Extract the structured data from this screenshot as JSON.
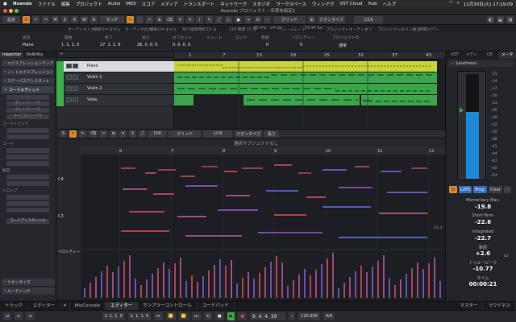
{
  "menubar": {
    "app": "Nuendo",
    "items": [
      "ファイル",
      "編集",
      "プロジェクト",
      "Audio",
      "MIDI",
      "スコア",
      "メディア",
      "トランスポート",
      "ネットワーク",
      "スタジオ",
      "ワークスペース",
      "ウィンドウ",
      "VST Cloud",
      "Hub",
      "ヘルプ"
    ],
    "clock": "11月30日(火) 17:19:09"
  },
  "titlebar": {
    "title": "Nuendo プロジェクト - 名称未設定1"
  },
  "toolbar": {
    "preset": "設定",
    "modes": [
      "M",
      "S",
      "R",
      "W",
      "A"
    ],
    "touch_mode": "タッチ",
    "grid_type": "グリッド",
    "quantize_label": "クオンタイズ",
    "quantize_value": "1/16"
  },
  "infoline": {
    "headers": [
      "名前",
      "開始",
      "終了",
      "長さ",
      "オフセット",
      "ミュート",
      "ロック",
      "移調",
      "ベロシティー",
      "プロジェクトの"
    ],
    "values": [
      "Piano",
      "1. 1. 1. 0",
      "27. 1. 1. 0",
      "26. 0. 0. 0",
      "0. 0. 0. 0",
      "",
      "",
      "0",
      "0",
      "通常"
    ],
    "status": [
      "オーディオ入力",
      "接続されません",
      "オーディオ出力",
      "接続されません",
      "残り録音時間 15 分",
      "120 時間 15 分",
      "48 kHz - 24 bit",
      "フレームレート",
      "59.94 fps",
      "プロジェクトオーディオ",
      "オフ",
      "プロジェクトのパン規正",
      "時間/パワー"
    ]
  },
  "inspector": {
    "tabs": [
      "Inspector",
      "Visibility"
    ],
    "sections": [
      "エクスプレッションマップ",
      "ノートエクスプレッション",
      "ステーパスアシスタント",
      "コードエディット"
    ],
    "chord_label": "コードトラック",
    "buttons": [
      "新しいコードを",
      "新しいコードを",
      "すべてのコードを"
    ],
    "sub_chord": "コード",
    "drop_label": "ドロップ",
    "root_label": "転回",
    "bottom_sections": [
      "クオンタイズ",
      "ルーティング"
    ],
    "assist_button": "コードアシスタントに"
  },
  "tracks": [
    {
      "name": "Piano",
      "selected": true
    },
    {
      "name": "Violin 1",
      "selected": false
    },
    {
      "name": "Violin 2",
      "selected": false
    },
    {
      "name": "Viola",
      "selected": false
    }
  ],
  "arrangement": {
    "ruler": [
      "1",
      "7",
      "13",
      "19",
      "25",
      "31",
      "37",
      "43"
    ],
    "part_label": "Viola",
    "colors": {
      "midi_part": "#3aa54a",
      "piano_part": "#c8d23a"
    }
  },
  "midi_editor": {
    "zoom": "100",
    "grid": "グリッド",
    "quantize_value": "1/16",
    "quantize_label": "クオンタイズ",
    "length_label": "長さ",
    "header": "選択オブジェクトなし",
    "ruler": [
      "6",
      "7",
      "8",
      "9",
      "10",
      "11",
      "12"
    ],
    "key_labels": [
      "C4",
      "C3"
    ],
    "lane_label": "ベロシティー"
  },
  "right_panel": {
    "tabs": [
      "VST",
      "メディ.",
      "CR",
      "メータ"
    ],
    "plugin": "Loudness",
    "meter_scale": [
      "-11",
      "-14",
      "-17",
      "-20",
      "-23",
      "-26",
      "-29",
      "-32",
      "-35",
      "-38",
      "-41",
      "-44",
      "-47",
      "-50",
      "-53"
    ],
    "mode_buttons": [
      "LUFS",
      "Prog.",
      "Clear"
    ],
    "momentary_label": "Momentary Max.",
    "momentary_value": "-19.8",
    "shortterm_label": "Short-Term",
    "shortterm_value": "-22.6",
    "side_value": "-21.3",
    "integrated_label": "Integrated",
    "integrated_value": "-22.7",
    "range_label": "範囲",
    "range_value": "+2.6",
    "lu_label": "LU",
    "truepeak_label": "トゥルーピーク",
    "truepeak_value": "-10.77",
    "time_label": "タイム",
    "time_value": "00:00:21"
  },
  "bottom_tabs": {
    "left": [
      "トラック",
      "エディター",
      "MixConsole",
      "エディター",
      "サンプラーコントロール",
      "コードパッド"
    ],
    "right": [
      "マスター",
      "ラウドネス"
    ]
  },
  "transport": {
    "position_left": "1. 1. 1. 0",
    "position_right": "1. 1. 1. 0",
    "position_main": "9. 4. 4. 39",
    "tempo": "120.000",
    "signature": "4/4"
  }
}
